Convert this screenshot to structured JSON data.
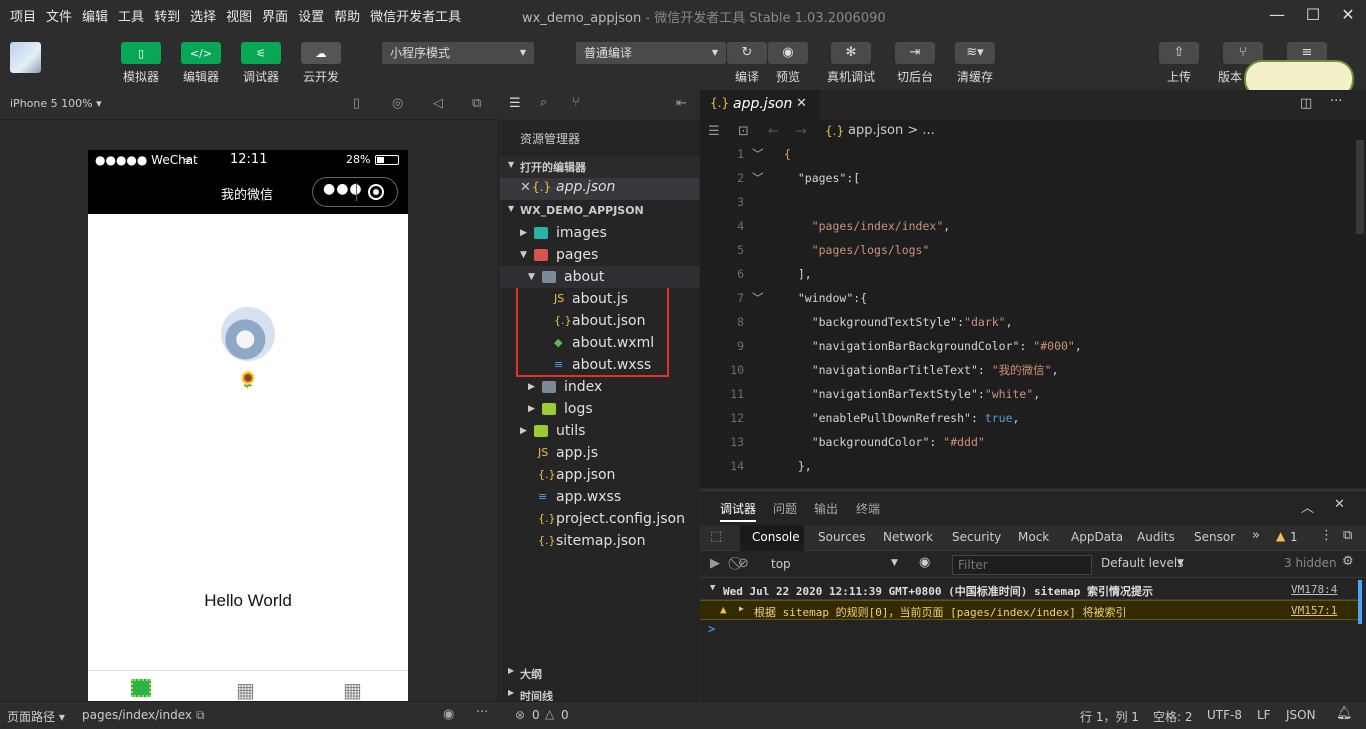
{
  "menu": [
    "项目",
    "文件",
    "编辑",
    "工具",
    "转到",
    "选择",
    "视图",
    "界面",
    "设置",
    "帮助",
    "微信开发者工具"
  ],
  "window": {
    "title": "wx_demo_appjson",
    "subtitle": "- 微信开发者工具 Stable 1.03.2006090"
  },
  "toolbar": {
    "simulator": "模拟器",
    "editor": "编辑器",
    "debugger": "调试器",
    "cloud": "云开发",
    "mode_select": "小程序模式",
    "compile_select": "普通编译",
    "compile": "编译",
    "preview": "预览",
    "device_debug": "真机调试",
    "background": "切后台",
    "clear_cache": "清缓存",
    "upload": "上传",
    "version": "版本"
  },
  "simulator": {
    "device": "iPhone 5 100% ▾",
    "status_left": "●●●●● WeChat",
    "time": "12:11",
    "battery": "28%",
    "nav_title": "我的微信",
    "emoji": "🌻",
    "hello": "Hello World"
  },
  "explorer": {
    "header": "资源管理器",
    "open_editors": "打开的编辑器",
    "open_file": "app.json",
    "project": "WX_DEMO_APPJSON",
    "tree": [
      {
        "name": "images",
        "kind": "folder",
        "level": 1,
        "open": false
      },
      {
        "name": "pages",
        "kind": "folder",
        "level": 1,
        "open": true
      },
      {
        "name": "about",
        "kind": "folder",
        "level": 2,
        "open": true
      },
      {
        "name": "about.js",
        "kind": "js",
        "level": 3
      },
      {
        "name": "about.json",
        "kind": "json",
        "level": 3
      },
      {
        "name": "about.wxml",
        "kind": "wxml",
        "level": 3
      },
      {
        "name": "about.wxss",
        "kind": "wxss",
        "level": 3
      },
      {
        "name": "index",
        "kind": "folder",
        "level": 2,
        "open": false
      },
      {
        "name": "logs",
        "kind": "folder",
        "level": 2,
        "open": false
      },
      {
        "name": "utils",
        "kind": "folder",
        "level": 1,
        "open": false
      },
      {
        "name": "app.js",
        "kind": "js",
        "level": 1
      },
      {
        "name": "app.json",
        "kind": "json",
        "level": 1
      },
      {
        "name": "app.wxss",
        "kind": "wxss",
        "level": 1
      },
      {
        "name": "project.config.json",
        "kind": "json",
        "level": 1
      },
      {
        "name": "sitemap.json",
        "kind": "json",
        "level": 1
      }
    ],
    "outline": "大纲",
    "timeline": "时间线"
  },
  "editor": {
    "tab": "app.json",
    "breadcrumb": "app.json > ...",
    "lines": [
      {
        "n": "1",
        "code": "{"
      },
      {
        "n": "2",
        "code": "  \"pages\":["
      },
      {
        "n": "3",
        "code": ""
      },
      {
        "n": "4",
        "code": "    \"pages/index/index\","
      },
      {
        "n": "5",
        "code": "    \"pages/logs/logs\""
      },
      {
        "n": "6",
        "code": "  ],"
      },
      {
        "n": "7",
        "code": "  \"window\":{"
      },
      {
        "n": "8",
        "code": "    \"backgroundTextStyle\":\"dark\","
      },
      {
        "n": "9",
        "code": "    \"navigationBarBackgroundColor\": \"#000\","
      },
      {
        "n": "10",
        "code": "    \"navigationBarTitleText\": \"我的微信\","
      },
      {
        "n": "11",
        "code": "    \"navigationBarTextStyle\":\"white\","
      },
      {
        "n": "12",
        "code": "    \"enablePullDownRefresh\": true,"
      },
      {
        "n": "13",
        "code": "    \"backgroundColor\": \"#ddd\""
      },
      {
        "n": "14",
        "code": "  },"
      }
    ]
  },
  "console": {
    "tabs": [
      "调试器",
      "问题",
      "输出",
      "终端"
    ],
    "devtabs": [
      "Console",
      "Sources",
      "Network",
      "Security",
      "Mock",
      "AppData",
      "Audits",
      "Sensor"
    ],
    "warn_count": "1",
    "context": "top",
    "filter_placeholder": "Filter",
    "levels": "Default levels",
    "hidden": "3 hidden",
    "group_text": "Wed Jul 22 2020 12:11:39 GMT+0800 (中国标准时间) sitemap 索引情况提示",
    "group_link": "VM178:4",
    "warn_text": "根据 sitemap 的规则[0]，当前页面 [pages/index/index] 将被索引",
    "warn_link": "VM157:1",
    "prompt": ">"
  },
  "status": {
    "page_path_label": "页面路径 ▾",
    "page_path": "pages/index/index",
    "errors": "0",
    "warnings": "0",
    "position": "行 1，列 1",
    "spaces": "空格: 2",
    "encoding": "UTF-8",
    "eol": "LF",
    "lang": "JSON"
  },
  "colors": {
    "accent": "#07a755",
    "highlight_box": "#e03030"
  }
}
